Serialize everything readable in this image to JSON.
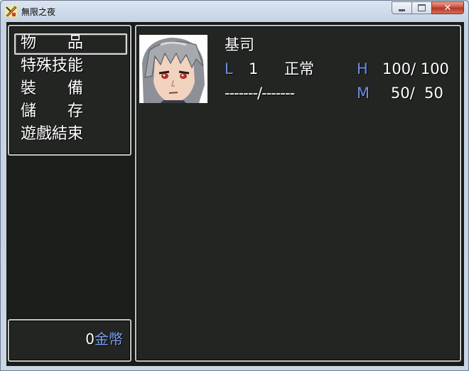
{
  "window": {
    "title": "無限之夜"
  },
  "menu": {
    "items": [
      "物　　品",
      "特殊技能",
      "裝　　備",
      "儲　　存",
      "遊戲結束"
    ],
    "selected_index": 0
  },
  "gold": {
    "amount": "0",
    "unit": "金幣"
  },
  "character": {
    "name": "基司",
    "level_label": "L",
    "level": "1",
    "condition": "正常",
    "hp_label": "H",
    "hp": "100/ 100",
    "exp": "-------/-------",
    "mp_label": "M",
    "mp": "50/  50"
  },
  "colors": {
    "accent_blue": "#6f8fe8",
    "panel_bg": "#222522",
    "border": "#c4c4c4"
  }
}
